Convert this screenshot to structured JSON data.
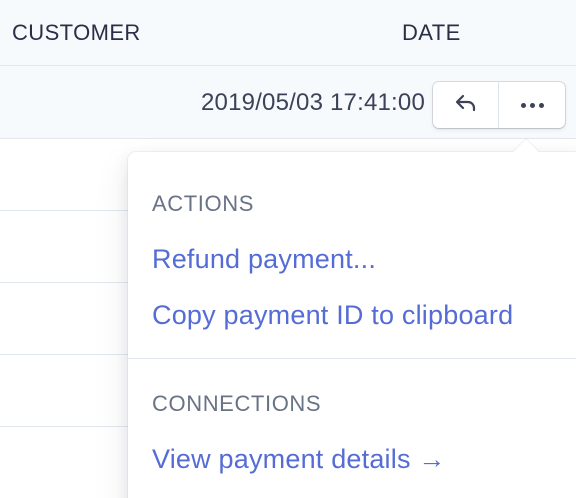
{
  "table": {
    "headers": {
      "customer": "CUSTOMER",
      "date": "DATE"
    },
    "first_row_date": "2019/05/03 17:41:00"
  },
  "row_actions": {
    "refund_icon": "reply-arrow-icon",
    "more_icon": "more-horizontal-icon"
  },
  "menu": {
    "actions_title": "ACTIONS",
    "refund_label": "Refund payment...",
    "copy_label": "Copy payment ID to clipboard",
    "connections_title": "CONNECTIONS",
    "view_label": "View payment details →"
  },
  "colors": {
    "link": "#556cd6",
    "header_bg": "#f7fafc",
    "text": "#3c4257",
    "muted": "#697386"
  }
}
